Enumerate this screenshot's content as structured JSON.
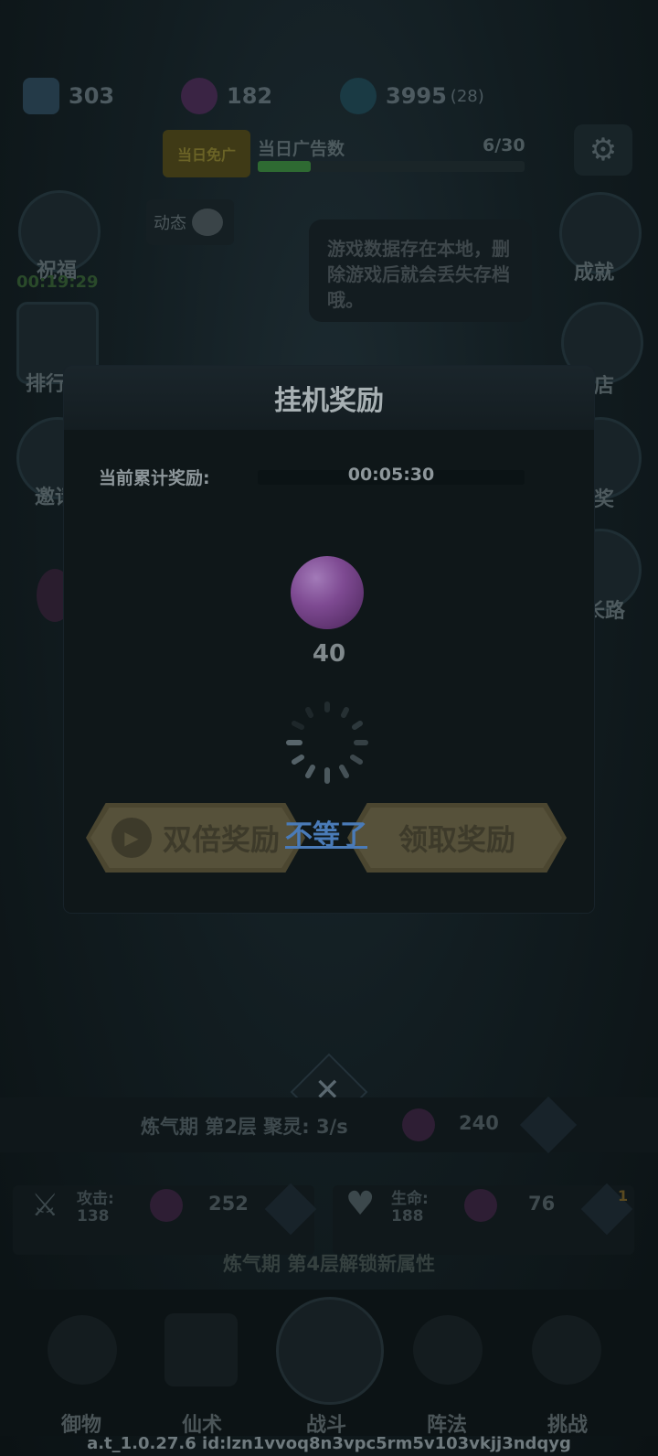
{
  "resources": {
    "crystal": "303",
    "orb": "182",
    "energy": "3995",
    "energy_extra": "(28)"
  },
  "ad_bar": {
    "badge": "当日免广",
    "label": "当日广告数",
    "count": "6/30",
    "progress": 0.2
  },
  "left_menu": [
    {
      "label": "祝福",
      "timer": "00:19:29"
    },
    {
      "label": "排行"
    },
    {
      "label": "邀请"
    }
  ],
  "right_menu": [
    {
      "label": "成就"
    },
    {
      "label": "商店"
    },
    {
      "label": "抽奖"
    },
    {
      "label": "成长路"
    }
  ],
  "news_label": "动态",
  "tip_text": "游戏数据存在本地，删除游戏后就会丢失存档哦。",
  "modal": {
    "title": "挂机奖励",
    "accum_label": "当前累计奖励:",
    "accum_time": "00:05:30",
    "reward_amount": "40",
    "double_btn": "双倍奖励",
    "claim_btn": "领取奖励",
    "skip_link": "不等了"
  },
  "level_bar": {
    "text": "炼气期 第2层 聚灵: 3/s",
    "cost": "240"
  },
  "stats": {
    "attack_label": "攻击:",
    "attack_value": "138",
    "attack_cost": "252",
    "life_label": "生命:",
    "life_value": "188",
    "life_cost": "76",
    "life_badge": "1"
  },
  "unlock_text": "炼气期 第4层解锁新属性",
  "bottom_nav": [
    "御物",
    "仙术",
    "战斗",
    "阵法",
    "挑战"
  ],
  "footer": "a.t_1.0.27.6 id:lzn1vvoq8n3vpc5rm5v103vkjj3ndqyg",
  "colors": {
    "accent_green": "#2e6a32",
    "link_blue": "#4a7bb8",
    "orb_purple": "#7e4a92"
  }
}
